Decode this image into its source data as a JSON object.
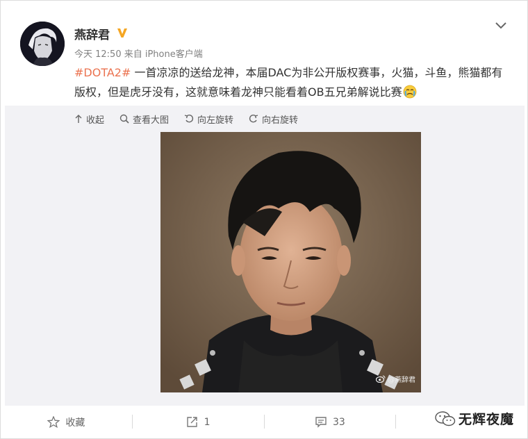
{
  "post": {
    "username": "燕辞君",
    "meta": "今天 12:50 来自 iPhone客户端",
    "hashtag": "#DOTA2#",
    "body": " 一首凉凉的送给龙神，本届DAC为非公开版权赛事，火猫，斗鱼，熊猫都有版权，但是虎牙没有，这就意味着龙神只能看着OB五兄弟解说比赛",
    "verified_badge": "V"
  },
  "media_toolbar": {
    "collapse": "收起",
    "view_large": "查看大图",
    "rotate_left": "向左旋转",
    "rotate_right": "向右旋转"
  },
  "photo": {
    "watermark": "@燕辞君"
  },
  "actions": {
    "favorite": "收藏",
    "repost_count": "1",
    "comment_count": "33"
  },
  "brand_watermark": "无辉夜魔",
  "colors": {
    "hashtag": "#eb7350",
    "badge": "#f5a623",
    "muted": "#808080",
    "media_bg": "#f2f2f5"
  },
  "icons": [
    "chevron-down-icon",
    "verified-badge-icon",
    "collapse-icon",
    "search-icon",
    "rotate-left-icon",
    "rotate-right-icon",
    "star-icon",
    "repost-icon",
    "comment-icon",
    "crying-emoji-icon",
    "weibo-logo-icon",
    "wechat-logo-icon"
  ]
}
